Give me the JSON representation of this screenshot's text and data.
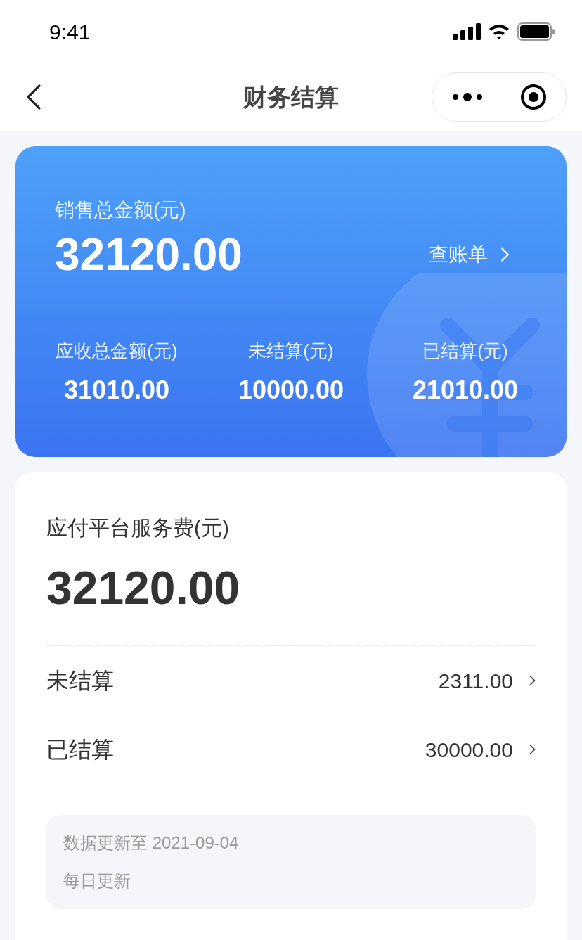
{
  "status_bar": {
    "time": "9:41"
  },
  "nav": {
    "title": "财务结算"
  },
  "summary": {
    "label": "销售总金额(元)",
    "amount": "32120.00",
    "link": "查账单",
    "stats": [
      {
        "label": "应收总金额(元)",
        "value": "31010.00"
      },
      {
        "label": "未结算(元)",
        "value": "10000.00"
      },
      {
        "label": "已结算(元)",
        "value": "21010.00"
      }
    ]
  },
  "fee": {
    "label": "应付平台服务费(元)",
    "amount": "32120.00",
    "rows": [
      {
        "label": "未结算",
        "value": "2311.00"
      },
      {
        "label": "已结算",
        "value": "30000.00"
      }
    ]
  },
  "note": {
    "lines": [
      "数据更新至 2021-09-04",
      "每日更新"
    ]
  }
}
